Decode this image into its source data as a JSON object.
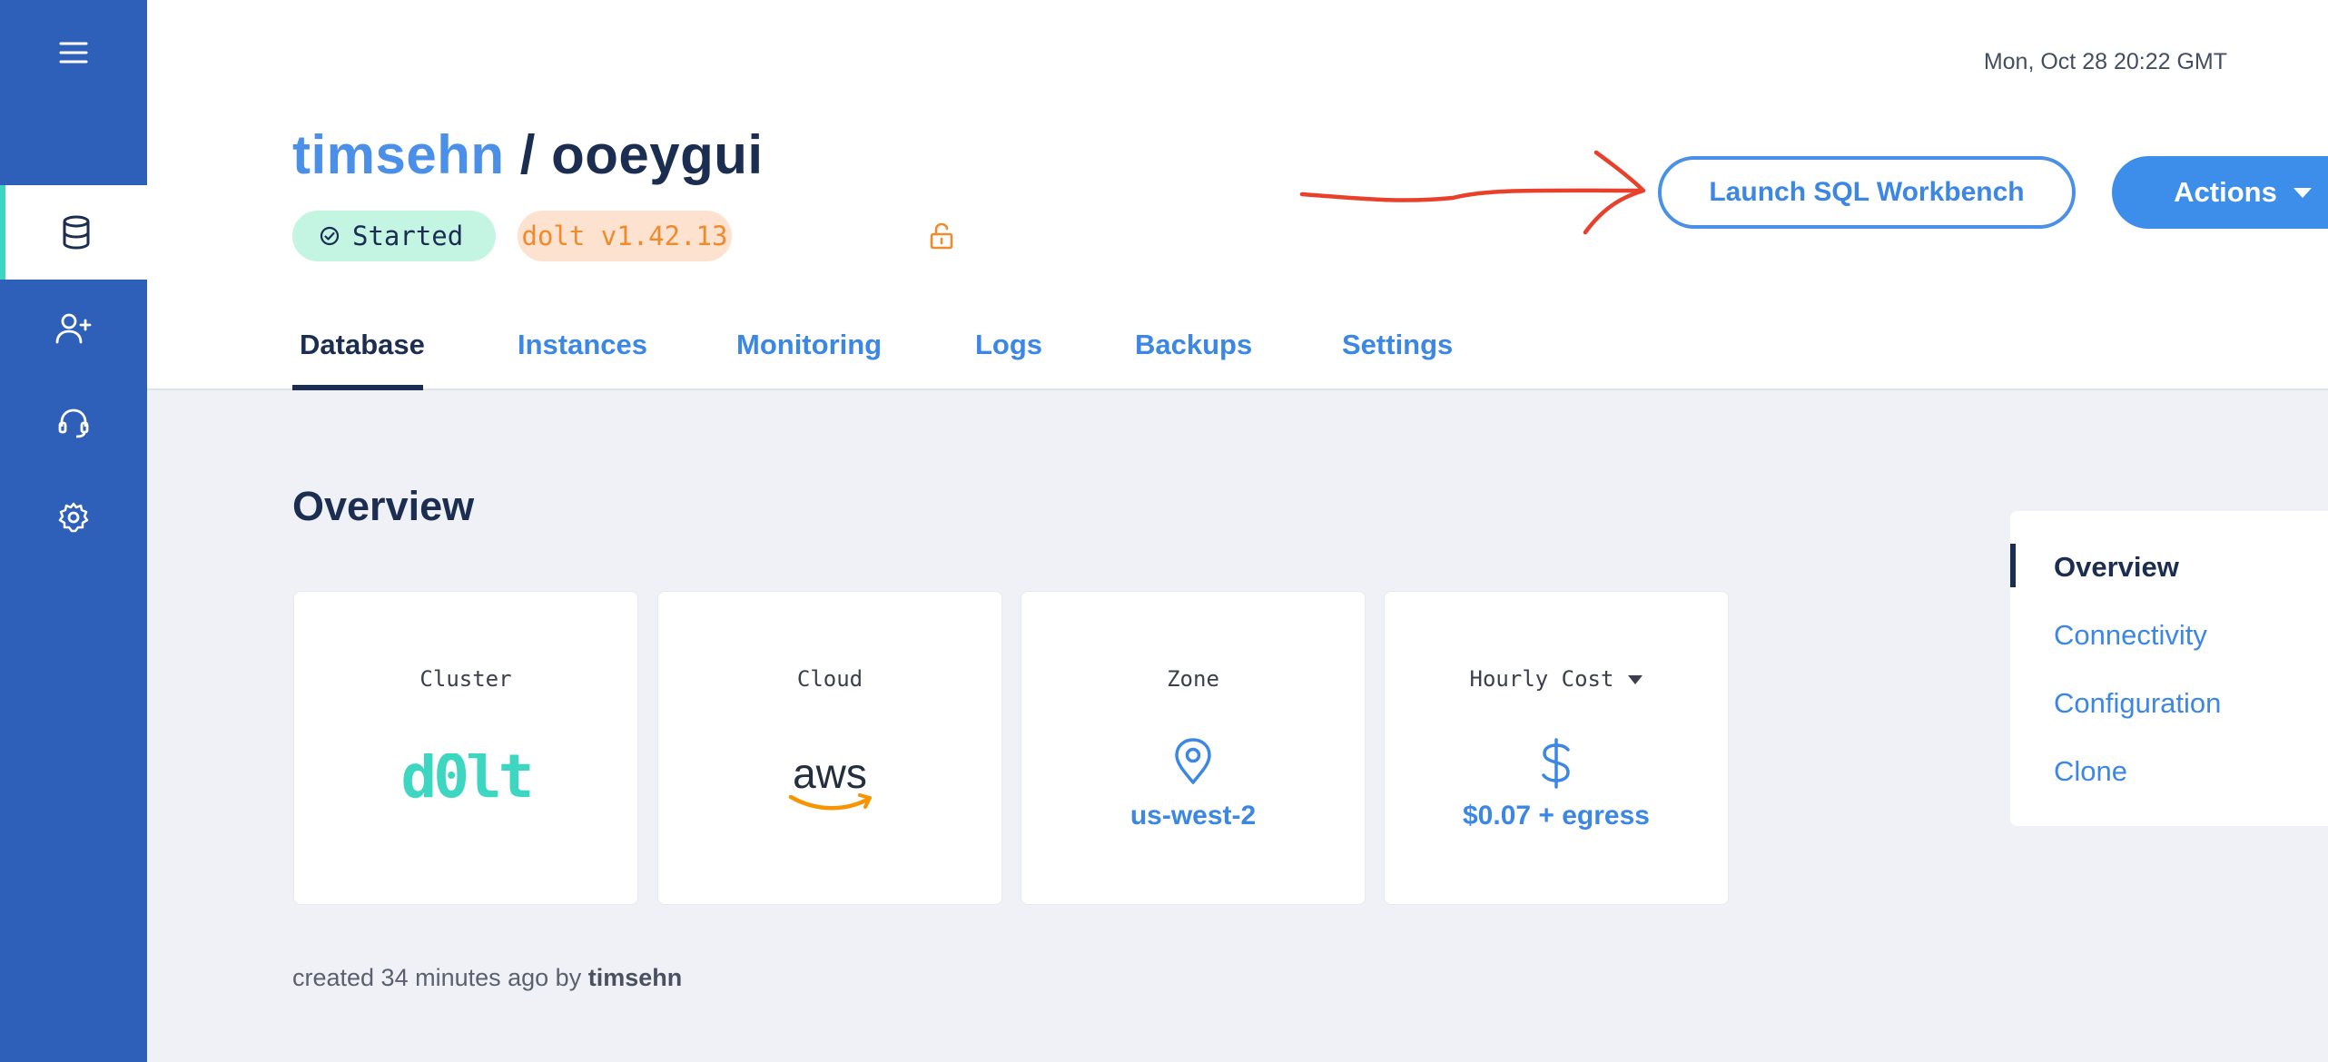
{
  "header": {
    "timestamp": "Mon, Oct 28 20:22 GMT",
    "owner": "timsehn",
    "separator": " / ",
    "database": "ooeygui",
    "status": "Started",
    "version": "dolt v1.42.13",
    "launch_button": "Launch SQL Workbench",
    "actions_button": "Actions"
  },
  "sidebar": {
    "items": [
      {
        "icon": "menu-icon"
      },
      {
        "icon": "database-icon",
        "active": true
      },
      {
        "icon": "add-user-icon"
      },
      {
        "icon": "support-headset-icon"
      },
      {
        "icon": "settings-gear-icon"
      }
    ]
  },
  "tabs": [
    {
      "label": "Database",
      "active": true
    },
    {
      "label": "Instances"
    },
    {
      "label": "Monitoring"
    },
    {
      "label": "Logs"
    },
    {
      "label": "Backups"
    },
    {
      "label": "Settings"
    }
  ],
  "overview": {
    "title": "Overview",
    "cards": [
      {
        "label": "Cluster",
        "logo": "dolt"
      },
      {
        "label": "Cloud",
        "logo": "aws"
      },
      {
        "label": "Zone",
        "value": "us-west-2",
        "icon": "location-pin-icon"
      },
      {
        "label": "Hourly Cost",
        "value": "$0.07 + egress",
        "icon": "dollar-icon"
      }
    ],
    "created_prefix": "created 34 minutes ago by ",
    "created_by": "timsehn"
  },
  "toc": {
    "items": [
      {
        "label": "Overview",
        "active": true
      },
      {
        "label": "Connectivity"
      },
      {
        "label": "Configuration"
      },
      {
        "label": "Clone"
      }
    ]
  },
  "colors": {
    "sidebar": "#2e5fb9",
    "accent": "#3c8eea",
    "navy": "#1b2e52",
    "teal": "#3dd6c0",
    "orange": "#ef8a2d",
    "annotation_arrow": "#e8402a"
  }
}
